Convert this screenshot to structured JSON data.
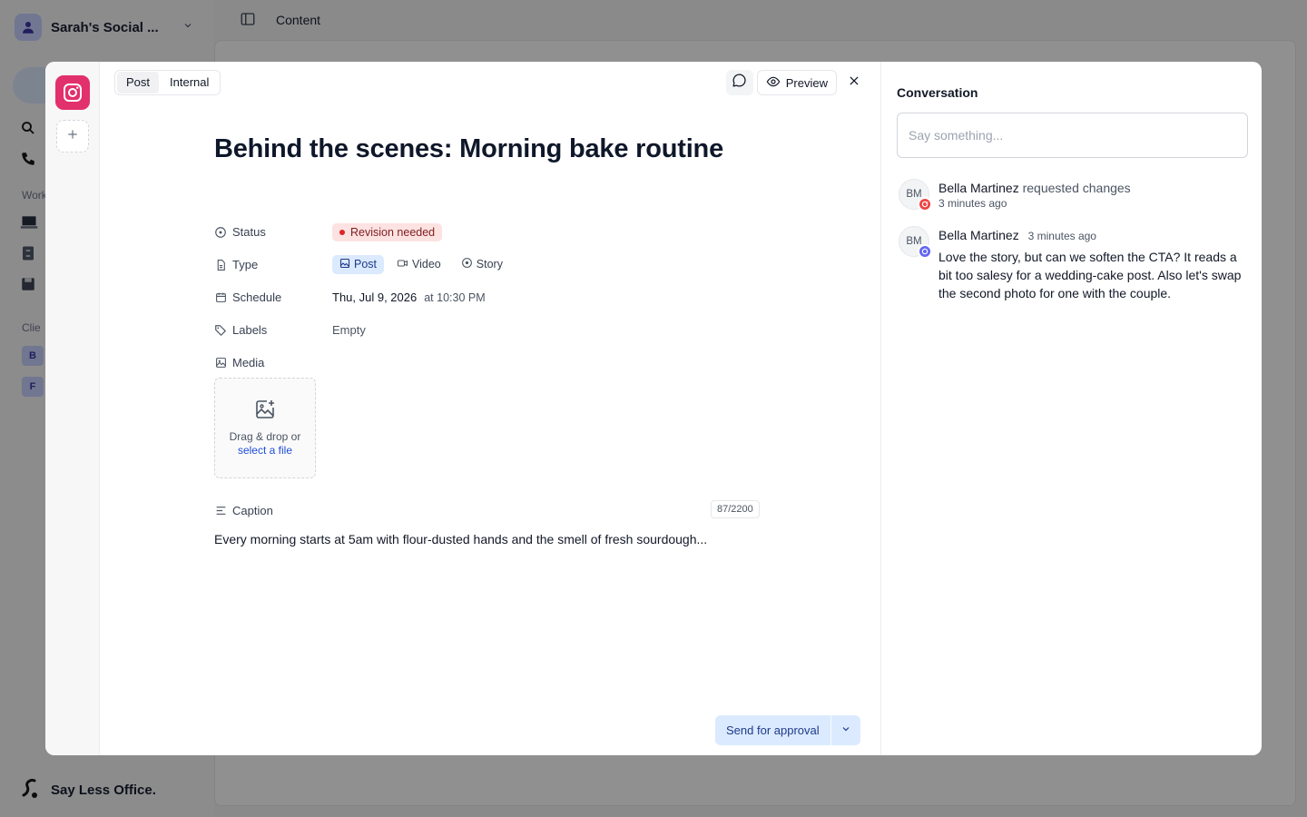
{
  "background": {
    "workspace_name": "Sarah's Social ...",
    "breadcrumb": "Content",
    "section_workspace": "Work",
    "section_clients": "Clie",
    "clients": [
      "B",
      "F"
    ],
    "footer_brand": "Say Less Office."
  },
  "modal": {
    "tabs": [
      {
        "label": "Post",
        "active": true
      },
      {
        "label": "Internal",
        "active": false
      }
    ],
    "preview_label": "Preview",
    "title": "Behind the scenes: Morning bake routine",
    "props": {
      "status_label": "Status",
      "status_value": "Revision needed",
      "type_label": "Type",
      "type_options": [
        {
          "label": "Post",
          "icon": "image-icon",
          "active": true
        },
        {
          "label": "Video",
          "icon": "video-icon",
          "active": false
        },
        {
          "label": "Story",
          "icon": "story-icon",
          "active": false
        }
      ],
      "schedule_label": "Schedule",
      "schedule_date": "Thu, Jul 9, 2026",
      "schedule_time": "at 10:30 PM",
      "labels_label": "Labels",
      "labels_value": "Empty",
      "media_label": "Media"
    },
    "dropzone": {
      "text": "Drag & drop or",
      "link": "select a file"
    },
    "caption": {
      "label": "Caption",
      "counter": "87/2200",
      "text": "Every morning starts at 5am with flour-dusted hands and the smell of fresh sourdough..."
    },
    "send_label": "Send for approval"
  },
  "conversation": {
    "title": "Conversation",
    "input_placeholder": "Say something...",
    "activities": [
      {
        "initials": "BM",
        "name": "Bella Martinez",
        "action": "requested changes",
        "time": "3 minutes ago",
        "badge": "revision-icon"
      },
      {
        "initials": "BM",
        "name": "Bella Martinez",
        "time": "3 minutes ago",
        "comment": "Love the story, but can we soften the CTA? It reads a bit too salesy for a wedding-cake post. Also let's swap the second photo for one with the couple.",
        "badge": "comment-icon"
      }
    ]
  },
  "colors": {
    "instagram": "#e1306c",
    "status_bg": "#fde2e2",
    "status_dot": "#dc2626",
    "type_active_bg": "#dbeafe",
    "send_bg": "#dbeafe",
    "badge_revision": "#ef4444",
    "badge_comment": "#6366f1"
  }
}
